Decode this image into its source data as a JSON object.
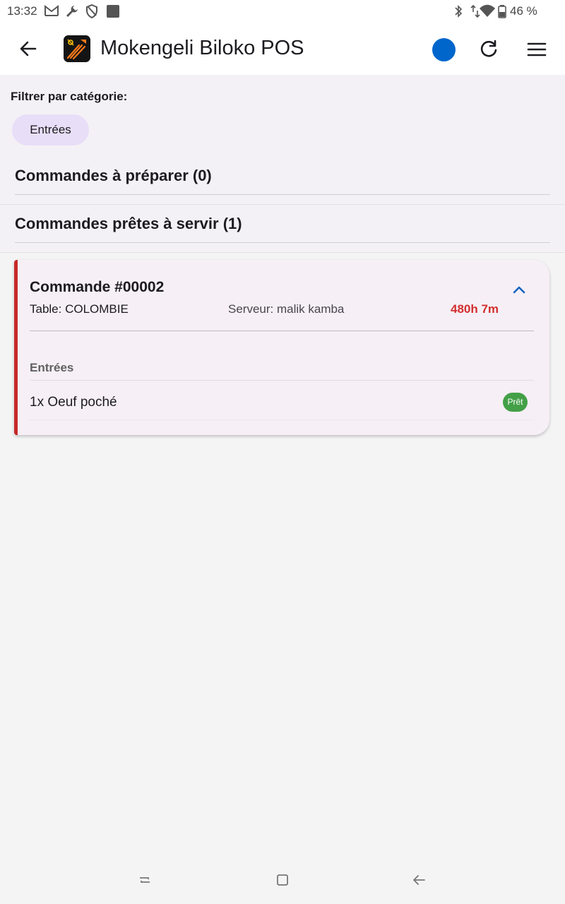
{
  "status_bar": {
    "time": "13:32",
    "battery_text": "46 %",
    "left_icons": [
      "gmail-icon",
      "wrench-icon",
      "shield-icon",
      "square-notification-icon"
    ],
    "right_icons": [
      "bluetooth-icon",
      "data-arrows-icon",
      "wifi-icon",
      "battery-icon"
    ]
  },
  "app_bar": {
    "title": "Mokengeli Biloko POS",
    "back_icon": "arrow-left-icon",
    "logo_icon": "fork-knife-logo-icon",
    "refresh_icon": "refresh-icon",
    "menu_icon": "hamburger-menu-icon",
    "status_color": "#0066cc"
  },
  "filter": {
    "label": "Filtrer par catégorie:",
    "chips": [
      {
        "label": "Entrées",
        "selected": true
      }
    ]
  },
  "sections": [
    {
      "label": "Commandes à préparer (0)"
    },
    {
      "label": "Commandes prêtes à servir (1)"
    }
  ],
  "order": {
    "title": "Commande #00002",
    "table": "Table: COLOMBIE",
    "server": "Serveur: malik kamba",
    "elapsed": "480h 7m",
    "accent_color": "#c62828",
    "categories": [
      {
        "name": "Entrées",
        "items": [
          {
            "text": "1x Oeuf poché",
            "status": "Prêt",
            "status_color": "#43a047"
          }
        ]
      }
    ]
  },
  "nav_bar": {
    "buttons": [
      "recents-icon",
      "home-icon",
      "back-icon"
    ]
  }
}
